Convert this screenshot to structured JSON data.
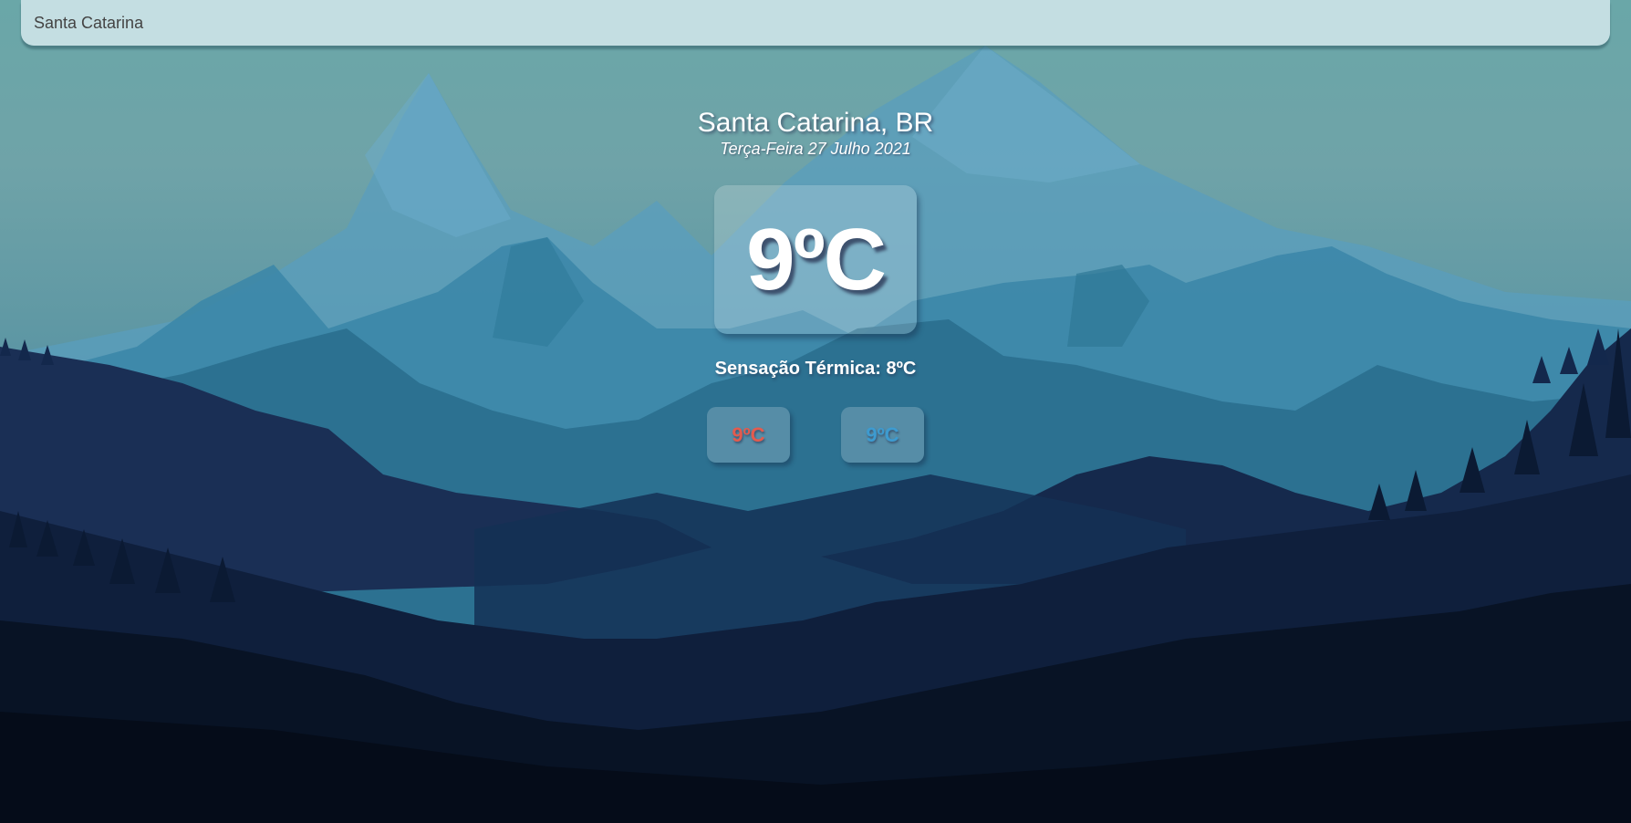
{
  "search": {
    "value": "Santa Catarina"
  },
  "weather": {
    "location": "Santa Catarina, BR",
    "date": "Terça-Feira 27 Julho 2021",
    "temperature": "9ºC",
    "feels_like": "Sensação Térmica: 8ºC",
    "max_temp": "9ºC",
    "min_temp": "9ºC"
  },
  "colors": {
    "max_temp": "#e35b4e",
    "min_temp": "#3d9bd0"
  }
}
